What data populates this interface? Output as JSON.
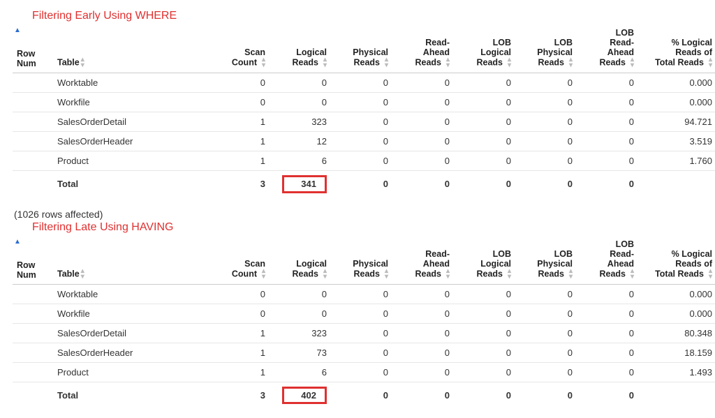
{
  "columns": {
    "rownum": "Row Num",
    "table": "Table",
    "scan_count": "Scan Count",
    "logical_reads": "Logical Reads",
    "physical_reads": "Physical Reads",
    "read_ahead": "Read-Ahead Reads",
    "lob_logical": "LOB Logical Reads",
    "lob_physical": "LOB Physical Reads",
    "lob_read_ahead": "LOB Read-Ahead Reads",
    "pct_logical": "% Logical Reads of Total Reads"
  },
  "sections": [
    {
      "title": "Filtering Early Using WHERE",
      "highlight_total_logical": true,
      "rows": [
        {
          "table": "Worktable",
          "scan_count": "0",
          "logical_reads": "0",
          "physical_reads": "0",
          "read_ahead": "0",
          "lob_logical": "0",
          "lob_physical": "0",
          "lob_read_ahead": "0",
          "pct": "0.000"
        },
        {
          "table": "Workfile",
          "scan_count": "0",
          "logical_reads": "0",
          "physical_reads": "0",
          "read_ahead": "0",
          "lob_logical": "0",
          "lob_physical": "0",
          "lob_read_ahead": "0",
          "pct": "0.000"
        },
        {
          "table": "SalesOrderDetail",
          "scan_count": "1",
          "logical_reads": "323",
          "physical_reads": "0",
          "read_ahead": "0",
          "lob_logical": "0",
          "lob_physical": "0",
          "lob_read_ahead": "0",
          "pct": "94.721"
        },
        {
          "table": "SalesOrderHeader",
          "scan_count": "1",
          "logical_reads": "12",
          "physical_reads": "0",
          "read_ahead": "0",
          "lob_logical": "0",
          "lob_physical": "0",
          "lob_read_ahead": "0",
          "pct": "3.519"
        },
        {
          "table": "Product",
          "scan_count": "1",
          "logical_reads": "6",
          "physical_reads": "0",
          "read_ahead": "0",
          "lob_logical": "0",
          "lob_physical": "0",
          "lob_read_ahead": "0",
          "pct": "1.760"
        }
      ],
      "total": {
        "table": "Total",
        "scan_count": "3",
        "logical_reads": "341",
        "physical_reads": "0",
        "read_ahead": "0",
        "lob_logical": "0",
        "lob_physical": "0",
        "lob_read_ahead": "0",
        "pct": ""
      }
    },
    {
      "title": "Filtering Late Using HAVING",
      "highlight_total_logical": true,
      "rows": [
        {
          "table": "Worktable",
          "scan_count": "0",
          "logical_reads": "0",
          "physical_reads": "0",
          "read_ahead": "0",
          "lob_logical": "0",
          "lob_physical": "0",
          "lob_read_ahead": "0",
          "pct": "0.000"
        },
        {
          "table": "Workfile",
          "scan_count": "0",
          "logical_reads": "0",
          "physical_reads": "0",
          "read_ahead": "0",
          "lob_logical": "0",
          "lob_physical": "0",
          "lob_read_ahead": "0",
          "pct": "0.000"
        },
        {
          "table": "SalesOrderDetail",
          "scan_count": "1",
          "logical_reads": "323",
          "physical_reads": "0",
          "read_ahead": "0",
          "lob_logical": "0",
          "lob_physical": "0",
          "lob_read_ahead": "0",
          "pct": "80.348"
        },
        {
          "table": "SalesOrderHeader",
          "scan_count": "1",
          "logical_reads": "73",
          "physical_reads": "0",
          "read_ahead": "0",
          "lob_logical": "0",
          "lob_physical": "0",
          "lob_read_ahead": "0",
          "pct": "18.159"
        },
        {
          "table": "Product",
          "scan_count": "1",
          "logical_reads": "6",
          "physical_reads": "0",
          "read_ahead": "0",
          "lob_logical": "0",
          "lob_physical": "0",
          "lob_read_ahead": "0",
          "pct": "1.493"
        }
      ],
      "total": {
        "table": "Total",
        "scan_count": "3",
        "logical_reads": "402",
        "physical_reads": "0",
        "read_ahead": "0",
        "lob_logical": "0",
        "lob_physical": "0",
        "lob_read_ahead": "0",
        "pct": ""
      }
    }
  ],
  "rows_affected_text": "(1026 rows affected)",
  "chart_data": [
    {
      "type": "table",
      "title": "Filtering Early Using WHERE",
      "columns": [
        "Table",
        "Scan Count",
        "Logical Reads",
        "Physical Reads",
        "Read-Ahead Reads",
        "LOB Logical Reads",
        "LOB Physical Reads",
        "LOB Read-Ahead Reads",
        "% Logical Reads of Total Reads"
      ],
      "rows": [
        [
          "Worktable",
          0,
          0,
          0,
          0,
          0,
          0,
          0,
          0.0
        ],
        [
          "Workfile",
          0,
          0,
          0,
          0,
          0,
          0,
          0,
          0.0
        ],
        [
          "SalesOrderDetail",
          1,
          323,
          0,
          0,
          0,
          0,
          0,
          94.721
        ],
        [
          "SalesOrderHeader",
          1,
          12,
          0,
          0,
          0,
          0,
          0,
          3.519
        ],
        [
          "Product",
          1,
          6,
          0,
          0,
          0,
          0,
          0,
          1.76
        ],
        [
          "Total",
          3,
          341,
          0,
          0,
          0,
          0,
          0,
          null
        ]
      ]
    },
    {
      "type": "table",
      "title": "Filtering Late Using HAVING",
      "columns": [
        "Table",
        "Scan Count",
        "Logical Reads",
        "Physical Reads",
        "Read-Ahead Reads",
        "LOB Logical Reads",
        "LOB Physical Reads",
        "LOB Read-Ahead Reads",
        "% Logical Reads of Total Reads"
      ],
      "rows": [
        [
          "Worktable",
          0,
          0,
          0,
          0,
          0,
          0,
          0,
          0.0
        ],
        [
          "Workfile",
          0,
          0,
          0,
          0,
          0,
          0,
          0,
          0.0
        ],
        [
          "SalesOrderDetail",
          1,
          323,
          0,
          0,
          0,
          0,
          0,
          80.348
        ],
        [
          "SalesOrderHeader",
          1,
          73,
          0,
          0,
          0,
          0,
          0,
          18.159
        ],
        [
          "Product",
          1,
          6,
          0,
          0,
          0,
          0,
          0,
          1.493
        ],
        [
          "Total",
          3,
          402,
          0,
          0,
          0,
          0,
          0,
          null
        ]
      ]
    }
  ]
}
